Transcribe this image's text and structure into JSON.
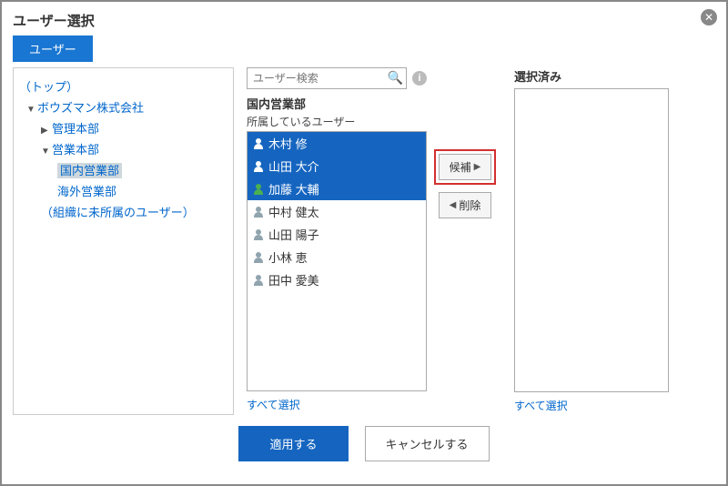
{
  "title": "ユーザー選択",
  "tab": "ユーザー",
  "tree": {
    "top": "（トップ）",
    "company": "ボウズマン株式会社",
    "admin": "管理本部",
    "sales": "営業本部",
    "domestic": "国内営業部",
    "overseas": "海外営業部",
    "noOrg": "（組織に未所属のユーザー）"
  },
  "search": {
    "placeholder": "ユーザー検索"
  },
  "middle": {
    "dept": "国内営業部",
    "subLabel": "所属しているユーザー",
    "users": [
      {
        "name": "木村 修",
        "selected": true,
        "color": "s"
      },
      {
        "name": "山田 大介",
        "selected": true,
        "color": "s"
      },
      {
        "name": "加藤 大輔",
        "selected": true,
        "color": "g"
      },
      {
        "name": "中村 健太",
        "selected": false,
        "color": "n"
      },
      {
        "name": "山田 陽子",
        "selected": false,
        "color": "n"
      },
      {
        "name": "小林 恵",
        "selected": false,
        "color": "n"
      },
      {
        "name": "田中 愛美",
        "selected": false,
        "color": "n"
      }
    ],
    "selectAll": "すべて選択"
  },
  "transfer": {
    "add": "候補",
    "remove": "削除"
  },
  "right": {
    "title": "選択済み",
    "selectAll": "すべて選択"
  },
  "footer": {
    "apply": "適用する",
    "cancel": "キャンセルする"
  }
}
